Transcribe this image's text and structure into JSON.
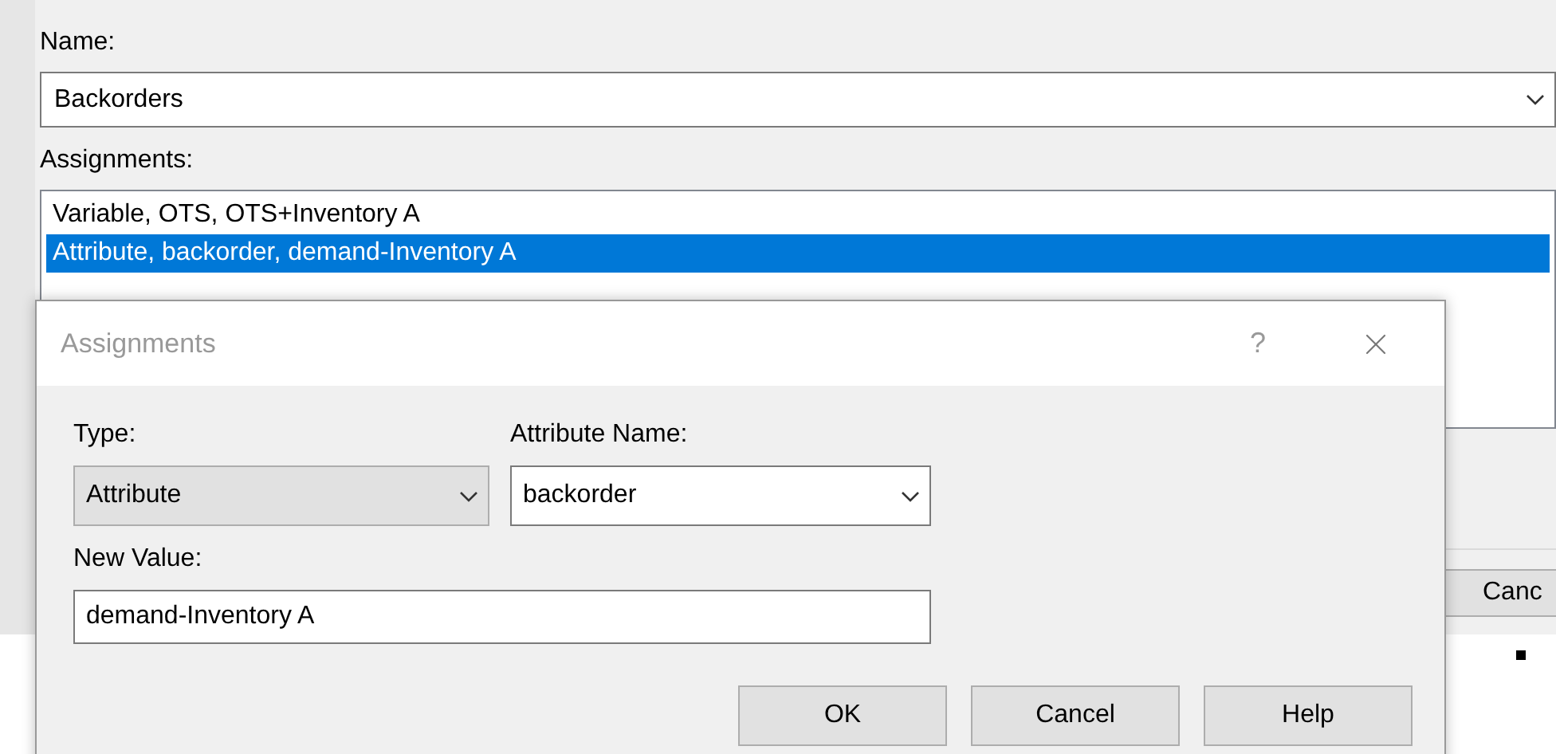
{
  "name_field": {
    "label": "Name:",
    "value": "Backorders"
  },
  "assignments": {
    "label": "Assignments:",
    "items": [
      {
        "text": "Variable, OTS, OTS+Inventory A",
        "selected": false
      },
      {
        "text": "Attribute, backorder, demand-Inventory A",
        "selected": true
      }
    ]
  },
  "background_buttons": [
    "Canc"
  ],
  "dialog": {
    "title": "Assignments",
    "help": "?",
    "type": {
      "label": "Type:",
      "value": "Attribute",
      "disabled": true
    },
    "attribute_name": {
      "label": "Attribute Name:",
      "value": "backorder",
      "disabled": false
    },
    "new_value": {
      "label": "New Value:",
      "value": "demand-Inventory A"
    },
    "buttons": [
      "OK",
      "Cancel",
      "Help"
    ]
  }
}
